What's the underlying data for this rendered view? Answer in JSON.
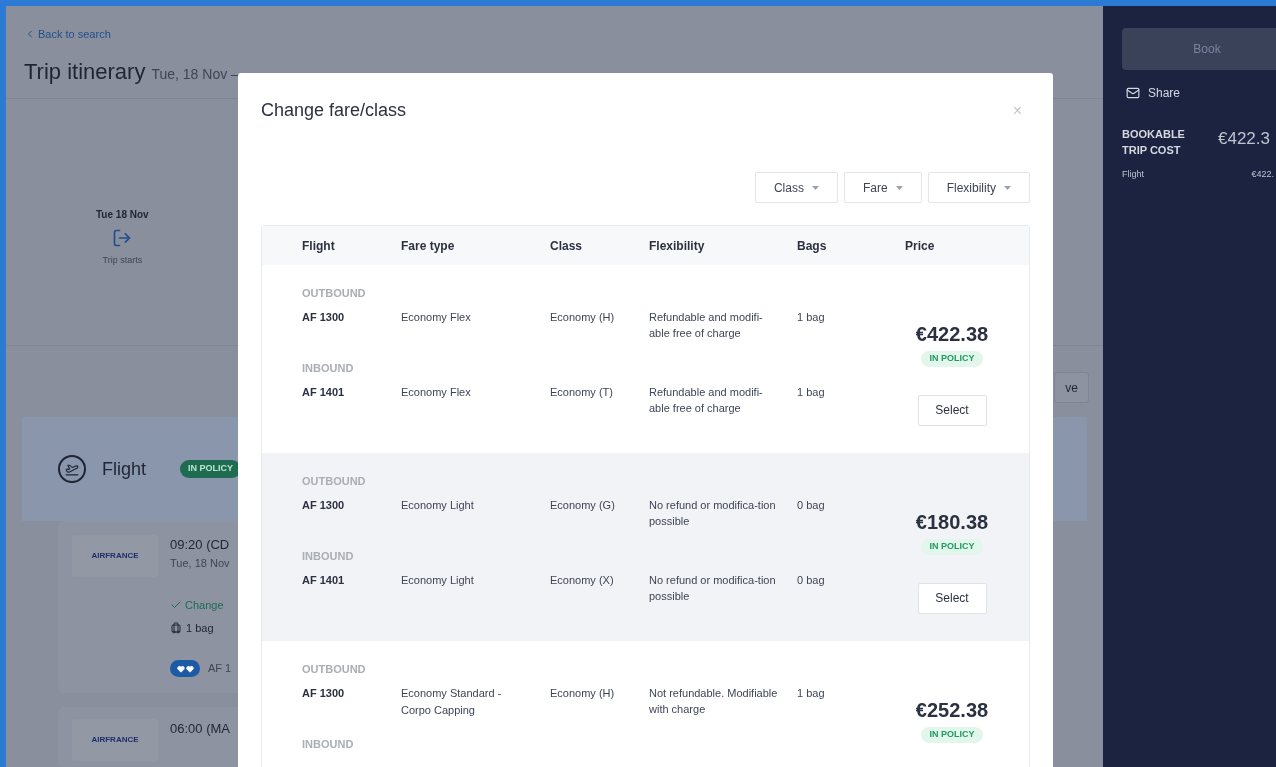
{
  "back_link": "Back to search",
  "page_title": "Trip itinerary",
  "page_dates": "Tue, 18 Nov –",
  "timeline": {
    "date": "Tue 18 Nov",
    "label": "Trip starts"
  },
  "partial_button": "ve",
  "flight_section": {
    "title": "Flight",
    "badge": "IN POLICY",
    "cards": [
      {
        "airline": "AIRFRANCE",
        "time": "09:20 (CD",
        "date": "Tue, 18 Nov",
        "change": "Change",
        "bags": "1 bag",
        "flight": "AF 1"
      },
      {
        "airline": "AIRFRANCE",
        "time": "06:00 (MA"
      }
    ]
  },
  "sidebar": {
    "book": "Book",
    "share": "Share",
    "cost_label": "BOOKABLE TRIP COST",
    "cost_value": "€422.3",
    "lines": [
      {
        "label": "Flight",
        "value": "€422."
      }
    ]
  },
  "modal": {
    "title": "Change fare/class",
    "close": "×",
    "filters": [
      {
        "label": "Class"
      },
      {
        "label": "Fare"
      },
      {
        "label": "Flexibility"
      }
    ],
    "columns": [
      "Flight",
      "Fare type",
      "Class",
      "Flexibility",
      "Bags",
      "Price"
    ],
    "fares": [
      {
        "shaded": false,
        "price": "€422.38",
        "badge": "IN POLICY",
        "button": "Select",
        "legs": [
          {
            "direction": "OUTBOUND",
            "flight": "AF 1300",
            "fare_type": "Economy Flex",
            "class": "Economy (H)",
            "flexibility": "Refundable and modifi-able free of charge",
            "bags": "1 bag"
          },
          {
            "direction": "INBOUND",
            "flight": "AF 1401",
            "fare_type": "Economy Flex",
            "class": "Economy (T)",
            "flexibility": "Refundable and modifi-able free of charge",
            "bags": "1 bag"
          }
        ]
      },
      {
        "shaded": true,
        "price": "€180.38",
        "badge": "IN POLICY",
        "button": "Select",
        "legs": [
          {
            "direction": "OUTBOUND",
            "flight": "AF 1300",
            "fare_type": "Economy Light",
            "class": "Economy (G)",
            "flexibility": "No refund or modifica-tion possible",
            "bags": "0 bag"
          },
          {
            "direction": "INBOUND",
            "flight": "AF 1401",
            "fare_type": "Economy Light",
            "class": "Economy (X)",
            "flexibility": "No refund or modifica-tion possible",
            "bags": "0 bag"
          }
        ]
      },
      {
        "shaded": false,
        "price": "€252.38",
        "badge": "IN POLICY",
        "legs": [
          {
            "direction": "OUTBOUND",
            "flight": "AF 1300",
            "fare_type": "Economy Standard - Corpo Capping",
            "class": "Economy (H)",
            "flexibility": "Not refundable. Modifiable with charge",
            "bags": "1 bag"
          },
          {
            "direction": "INBOUND"
          }
        ]
      }
    ]
  }
}
